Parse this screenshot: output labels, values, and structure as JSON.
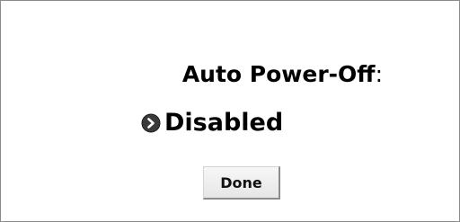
{
  "dialog": {
    "title": "Auto Power-Off",
    "title_colon": ":",
    "option": {
      "icon": "circle-chevron-right-icon",
      "label": "Disabled"
    },
    "done_label": "Done"
  }
}
